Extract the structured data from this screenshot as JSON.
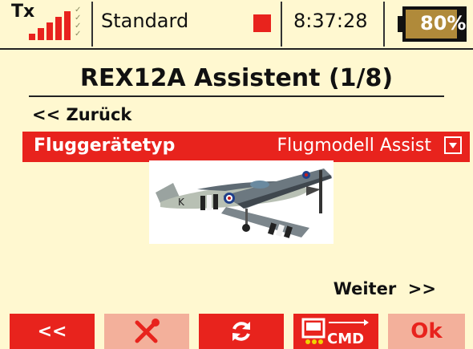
{
  "status": {
    "tx_label": "Tx",
    "profile": "Standard",
    "time": "8:37:28",
    "battery_percent": "80%",
    "battery_level": 0.8,
    "signal_bars": 5
  },
  "page": {
    "title": "REX12A Assistent (1/8)"
  },
  "nav": {
    "back": "<< Zurück",
    "next": "Weiter  >>"
  },
  "aircraft": {
    "label": "Fluggerätetyp",
    "value": "Flugmodell Assist"
  },
  "softkeys": {
    "back": "<<",
    "settings_icon": "wrench-screwdriver-icon",
    "refresh_icon": "refresh-icon",
    "cmd_icon": "cmd-icon",
    "cmd_label": "CMD",
    "ok": "Ok"
  },
  "colors": {
    "accent_red": "#e8231d",
    "disabled_red": "#f3b09b",
    "background": "#fff8d0"
  }
}
